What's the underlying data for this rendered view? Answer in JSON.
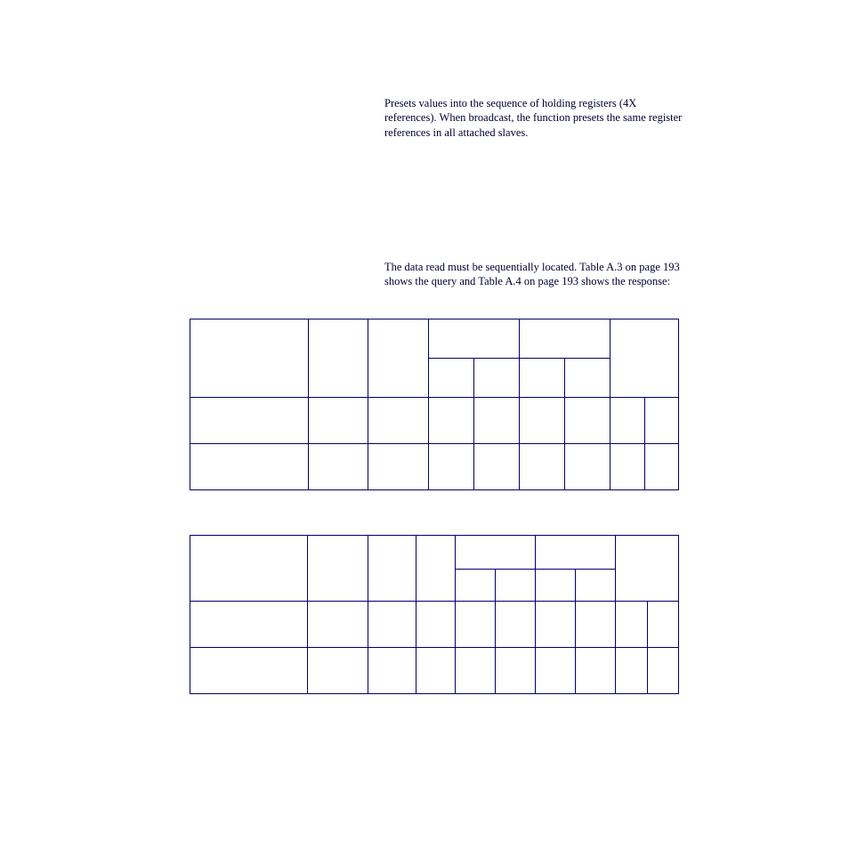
{
  "para1": "Presets values into the sequence of holding registers (4X references). When broadcast, the function presets the same register references in all attached slaves.",
  "para2": "The data read must be sequentially located. Table A.3 on page 193 shows the query and Table A.4 on page 193 shows the response:"
}
